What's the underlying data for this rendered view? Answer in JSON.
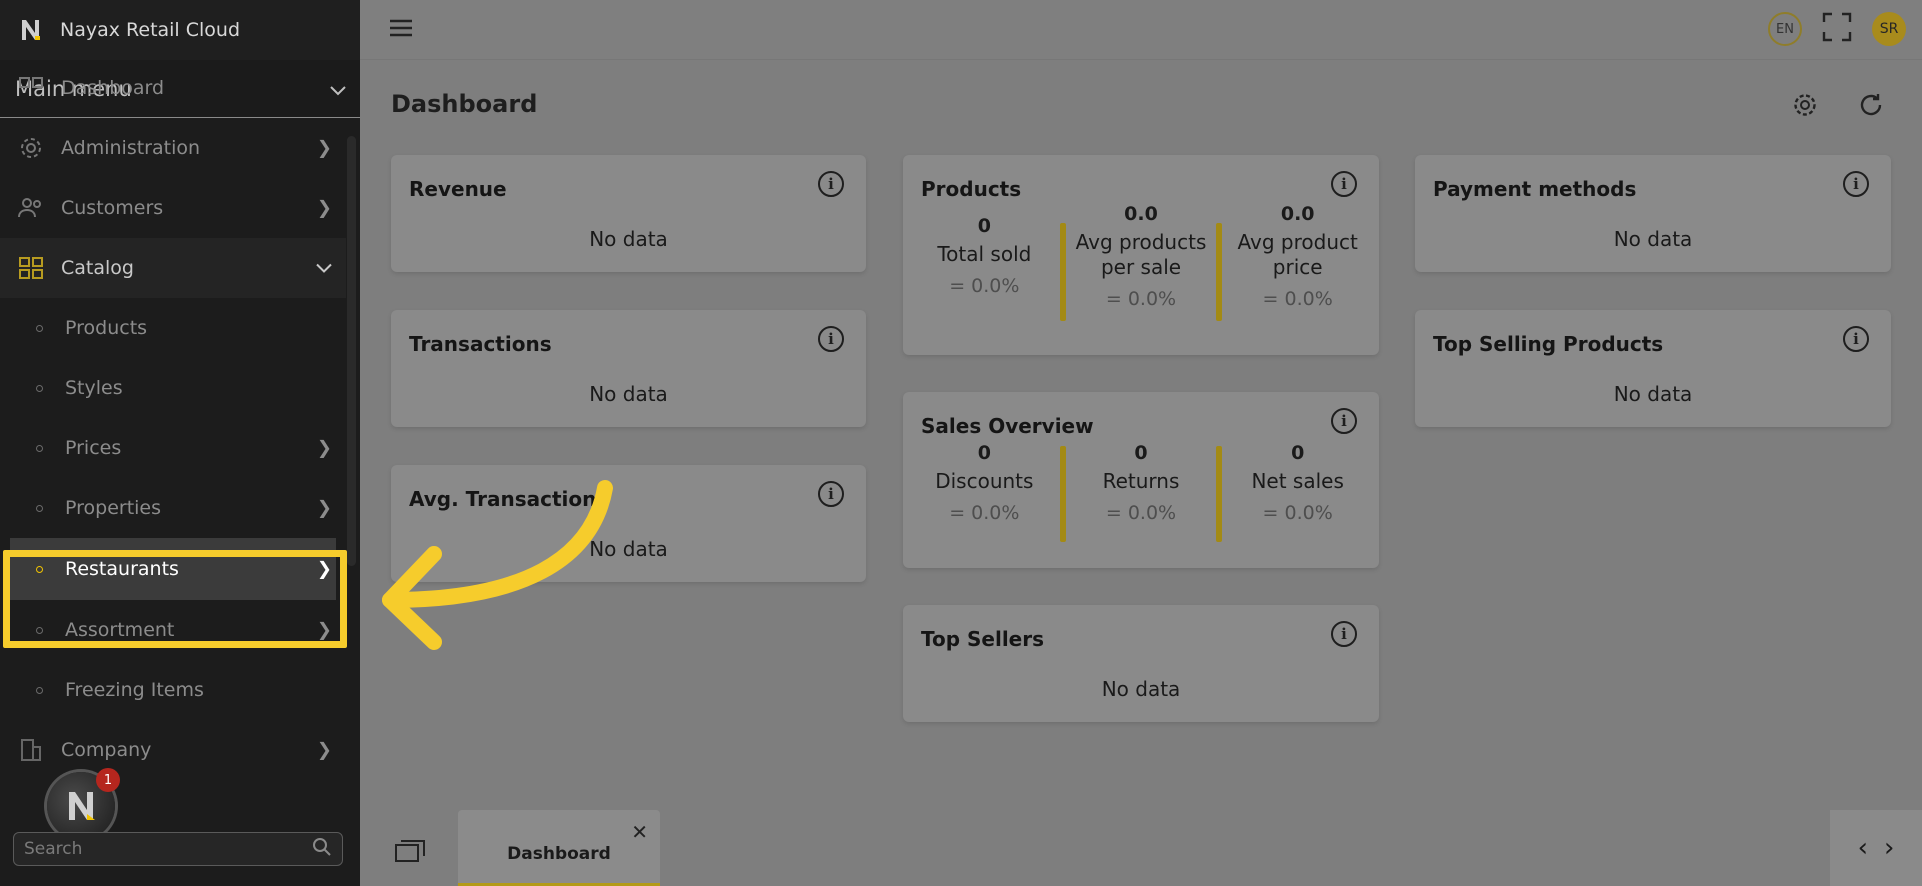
{
  "brand": {
    "name": "Nayax Retail Cloud"
  },
  "main_menu": {
    "label": "Main menu"
  },
  "sidebar": {
    "items": [
      {
        "label": "Dashboard"
      },
      {
        "label": "Administration"
      },
      {
        "label": "Customers"
      },
      {
        "label": "Catalog"
      },
      {
        "label": "Products"
      },
      {
        "label": "Styles"
      },
      {
        "label": "Prices"
      },
      {
        "label": "Properties"
      },
      {
        "label": "Restaurants"
      },
      {
        "label": "Assortment"
      },
      {
        "label": "Freezing Items"
      },
      {
        "label": "Company"
      }
    ]
  },
  "search": {
    "placeholder": "Search"
  },
  "notification": {
    "count": "1"
  },
  "topbar": {
    "lang": "EN",
    "user_initials": "SR"
  },
  "page": {
    "title": "Dashboard"
  },
  "cards": {
    "revenue": {
      "title": "Revenue",
      "empty": "No data"
    },
    "transactions": {
      "title": "Transactions",
      "empty": "No data"
    },
    "avg_transaction": {
      "title": "Avg. Transaction",
      "empty": "No data"
    },
    "products": {
      "title": "Products",
      "stats": [
        {
          "value": "0",
          "label": "Total sold",
          "change": "0.0%"
        },
        {
          "value": "0.0",
          "label": "Avg products per sale",
          "change": "0.0%"
        },
        {
          "value": "0.0",
          "label": "Avg product price",
          "change": "0.0%"
        }
      ]
    },
    "sales_overview": {
      "title": "Sales Overview",
      "stats": [
        {
          "value": "0",
          "label": "Discounts",
          "change": "0.0%"
        },
        {
          "value": "0",
          "label": "Returns",
          "change": "0.0%"
        },
        {
          "value": "0",
          "label": "Net sales",
          "change": "0.0%"
        }
      ]
    },
    "top_sellers": {
      "title": "Top Sellers",
      "empty": "No data"
    },
    "payment_methods": {
      "title": "Payment methods",
      "empty": "No data"
    },
    "top_selling_products": {
      "title": "Top Selling Products",
      "empty": "No data"
    }
  },
  "bottom_tabs": [
    {
      "label": "Dashboard"
    }
  ],
  "colors": {
    "accent": "#f6cc2c",
    "sidebar_bg": "#1c1c1c",
    "overlay_bg": "#7e7e7e"
  }
}
